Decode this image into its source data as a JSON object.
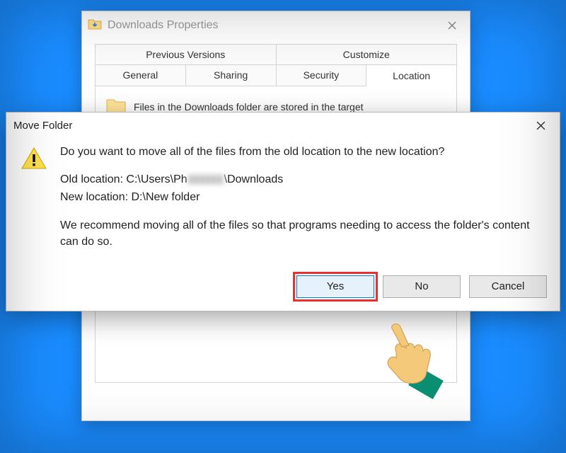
{
  "propWindow": {
    "title": "Downloads Properties",
    "tabsRow1": [
      "Previous Versions",
      "Customize"
    ],
    "tabsRow2": [
      "General",
      "Sharing",
      "Security",
      "Location"
    ],
    "activeTab": "Location",
    "locationDesc": "Files in the Downloads folder are stored in the target"
  },
  "dialog": {
    "title": "Move Folder",
    "question": "Do you want to move all of the files from the old location to the new location?",
    "oldLabel": "Old location:",
    "oldPathFront": "C:\\Users\\Ph",
    "oldPathRedacted": "xxxxxx",
    "oldPathBack": "\\Downloads",
    "newLabel": "New location:",
    "newPath": "D:\\New folder",
    "recommend": "We recommend moving all of the files so that programs needing to access the folder's content can do so.",
    "buttons": {
      "yes": "Yes",
      "no": "No",
      "cancel": "Cancel"
    }
  }
}
